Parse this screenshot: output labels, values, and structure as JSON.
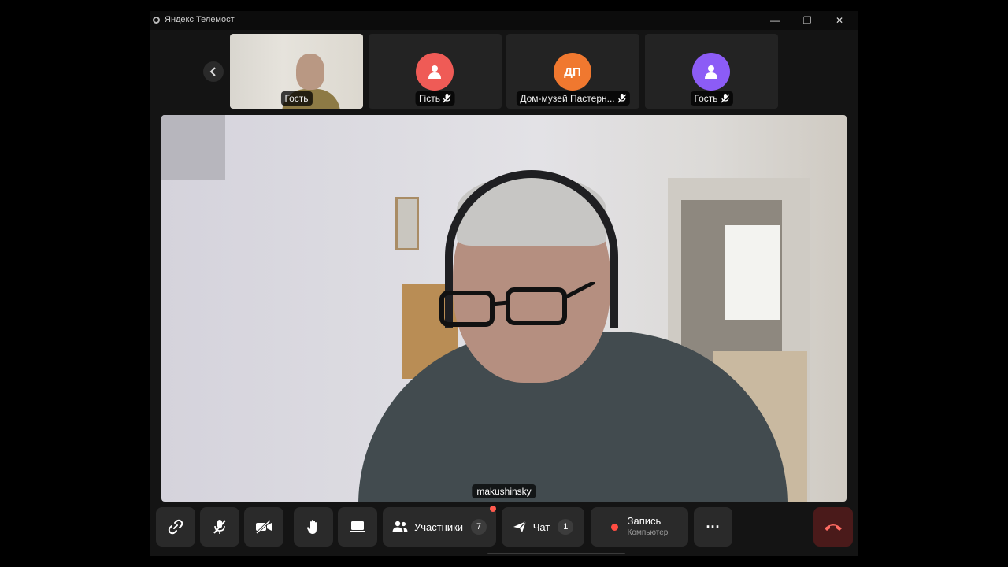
{
  "window": {
    "title": "Яндекс Телемост",
    "controls": {
      "minimize": "—",
      "maximize": "❐",
      "close": "✕"
    }
  },
  "participants_strip": [
    {
      "name": "Гость",
      "kind": "video",
      "muted": false
    },
    {
      "name": "Гість",
      "kind": "avatar",
      "color": "#ef5b56",
      "initials": "",
      "muted": true
    },
    {
      "name": "Дом-музей Пастерн...",
      "kind": "avatar",
      "color": "#f0782f",
      "initials": "ДП",
      "muted": true
    },
    {
      "name": "Гость",
      "kind": "avatar",
      "color": "#8c5cf6",
      "initials": "",
      "muted": true
    }
  ],
  "main_video": {
    "speaker_name": "makushinsky"
  },
  "toolbar": {
    "participants_label": "Участники",
    "participants_count": "7",
    "chat_label": "Чат",
    "chat_count": "1",
    "record_label": "Запись",
    "record_sub": "Компьютер",
    "more_label": "···"
  },
  "colors": {
    "background": "#141414",
    "control_bg": "#2a2a2a",
    "hangup_bg": "#4a1a1a",
    "record_dot": "#ff4d42"
  }
}
